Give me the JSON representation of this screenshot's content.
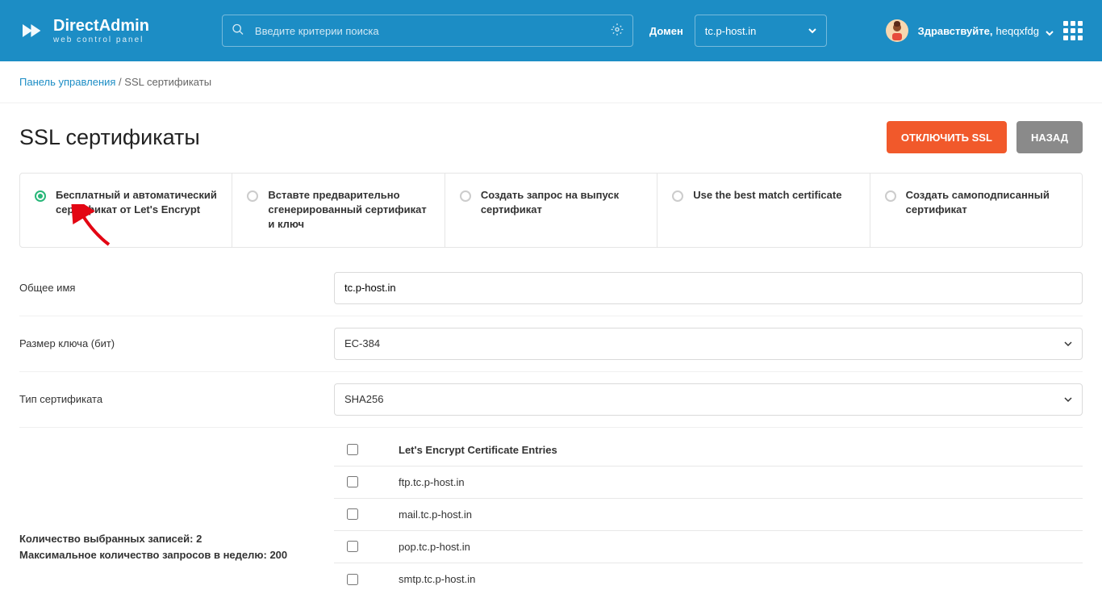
{
  "header": {
    "brand": "DirectAdmin",
    "subtitle": "web control panel",
    "search_placeholder": "Введите критерии поиска",
    "domain_label": "Домен",
    "domain_value": "tc.p-host.in",
    "greeting": "Здравствуйте,",
    "username": "heqqxfdg"
  },
  "breadcrumb": {
    "root": "Панель управления",
    "sep": " / ",
    "current": "SSL сертификаты"
  },
  "page": {
    "title": "SSL сертификаты",
    "btn_disable": "ОТКЛЮЧИТЬ SSL",
    "btn_back": "НАЗАД"
  },
  "tabs": [
    {
      "label": "Бесплатный и автоматический сертификат от Let's Encrypt",
      "active": true
    },
    {
      "label": "Вставте предварительно сгенерированный сертификат и ключ",
      "active": false
    },
    {
      "label": "Создать запрос на выпуск сертификат",
      "active": false
    },
    {
      "label": "Use the best match certificate",
      "active": false
    },
    {
      "label": "Создать самоподписанный сертификат",
      "active": false
    }
  ],
  "form": {
    "common_name_label": "Общее имя",
    "common_name_value": "tc.p-host.in",
    "key_size_label": "Размер ключа (бит)",
    "key_size_value": "EC-384",
    "cert_type_label": "Тип сертификата",
    "cert_type_value": "SHA256"
  },
  "table": {
    "header": "Let's Encrypt Certificate Entries",
    "entries": [
      "ftp.tc.p-host.in",
      "mail.tc.p-host.in",
      "pop.tc.p-host.in",
      "smtp.tc.p-host.in"
    ],
    "selected_count_label": "Количество выбранных записей:",
    "selected_count": "2",
    "max_requests_label": "Максимальное количество запросов в неделю:",
    "max_requests": "200"
  }
}
